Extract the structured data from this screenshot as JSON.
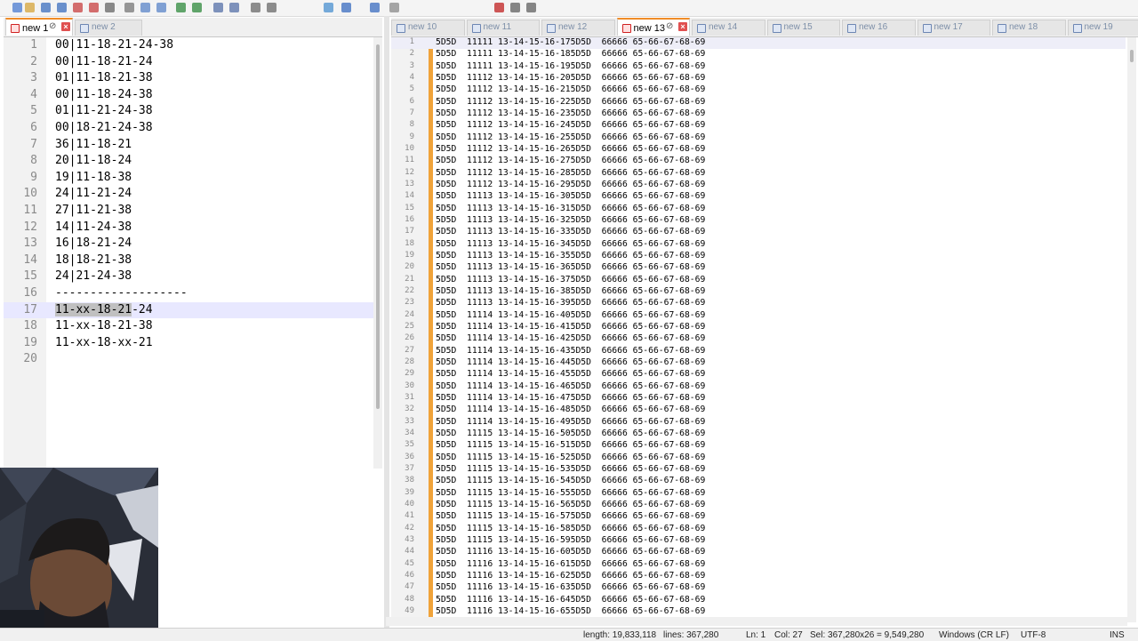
{
  "toolbar": {
    "icons": [
      "new-file-icon",
      "open-file-icon",
      "save-icon",
      "save-all-icon",
      "close-icon",
      "close-all-icon",
      "print-icon",
      "cut-icon",
      "copy-icon",
      "paste-icon",
      "undo-icon",
      "redo-icon",
      "find-icon",
      "replace-icon",
      "zoom-in-icon",
      "zoom-out-icon",
      "sync-scroll-icon",
      "word-wrap-icon",
      "show-all-icon",
      "indent-guide-icon",
      "macro-record-icon",
      "macro-stop-icon",
      "macro-play-icon"
    ]
  },
  "left_tabs": [
    {
      "label": "new 1",
      "active": true
    },
    {
      "label": "new 2",
      "active": false
    }
  ],
  "right_tabs": [
    {
      "label": "new 10",
      "active": false
    },
    {
      "label": "new 11",
      "active": false
    },
    {
      "label": "new 12",
      "active": false
    },
    {
      "label": "new 13",
      "active": true
    },
    {
      "label": "new 14",
      "active": false
    },
    {
      "label": "new 15",
      "active": false
    },
    {
      "label": "new 16",
      "active": false
    },
    {
      "label": "new 17",
      "active": false
    },
    {
      "label": "new 18",
      "active": false
    },
    {
      "label": "new 19",
      "active": false
    }
  ],
  "left_editor": {
    "current_line": 17,
    "highlight": "11-xx-18-21",
    "lines": [
      {
        "n": "1",
        "text": "00|11-18-21-24-38"
      },
      {
        "n": "2",
        "text": "00|11-18-21-24"
      },
      {
        "n": "3",
        "text": "01|11-18-21-38"
      },
      {
        "n": "4",
        "text": "00|11-18-24-38"
      },
      {
        "n": "5",
        "text": "01|11-21-24-38"
      },
      {
        "n": "6",
        "text": "00|18-21-24-38"
      },
      {
        "n": "7",
        "text": "36|11-18-21"
      },
      {
        "n": "8",
        "text": "20|11-18-24"
      },
      {
        "n": "9",
        "text": "19|11-18-38"
      },
      {
        "n": "10",
        "text": "24|11-21-24"
      },
      {
        "n": "11",
        "text": "27|11-21-38"
      },
      {
        "n": "12",
        "text": "14|11-24-38"
      },
      {
        "n": "13",
        "text": "16|18-21-24"
      },
      {
        "n": "14",
        "text": "18|18-21-38"
      },
      {
        "n": "15",
        "text": "24|21-24-38"
      },
      {
        "n": "16",
        "text": "-------------------"
      },
      {
        "n": "17",
        "text": "11-xx-18-21-24"
      },
      {
        "n": "18",
        "text": "11-xx-18-21-38"
      },
      {
        "n": "19",
        "text": "11-xx-18-xx-21"
      },
      {
        "n": "20",
        "text": ""
      }
    ]
  },
  "right_editor": {
    "current_line": 1,
    "lines": [
      {
        "n": "1",
        "text": "5D5D  11111 13-14-15-16-175D5D  66666 65-66-67-68-69"
      },
      {
        "n": "2",
        "text": "5D5D  11111 13-14-15-16-185D5D  66666 65-66-67-68-69"
      },
      {
        "n": "3",
        "text": "5D5D  11111 13-14-15-16-195D5D  66666 65-66-67-68-69"
      },
      {
        "n": "4",
        "text": "5D5D  11112 13-14-15-16-205D5D  66666 65-66-67-68-69"
      },
      {
        "n": "5",
        "text": "5D5D  11112 13-14-15-16-215D5D  66666 65-66-67-68-69"
      },
      {
        "n": "6",
        "text": "5D5D  11112 13-14-15-16-225D5D  66666 65-66-67-68-69"
      },
      {
        "n": "7",
        "text": "5D5D  11112 13-14-15-16-235D5D  66666 65-66-67-68-69"
      },
      {
        "n": "8",
        "text": "5D5D  11112 13-14-15-16-245D5D  66666 65-66-67-68-69"
      },
      {
        "n": "9",
        "text": "5D5D  11112 13-14-15-16-255D5D  66666 65-66-67-68-69"
      },
      {
        "n": "10",
        "text": "5D5D  11112 13-14-15-16-265D5D  66666 65-66-67-68-69"
      },
      {
        "n": "11",
        "text": "5D5D  11112 13-14-15-16-275D5D  66666 65-66-67-68-69"
      },
      {
        "n": "12",
        "text": "5D5D  11112 13-14-15-16-285D5D  66666 65-66-67-68-69"
      },
      {
        "n": "13",
        "text": "5D5D  11112 13-14-15-16-295D5D  66666 65-66-67-68-69"
      },
      {
        "n": "14",
        "text": "5D5D  11113 13-14-15-16-305D5D  66666 65-66-67-68-69"
      },
      {
        "n": "15",
        "text": "5D5D  11113 13-14-15-16-315D5D  66666 65-66-67-68-69"
      },
      {
        "n": "16",
        "text": "5D5D  11113 13-14-15-16-325D5D  66666 65-66-67-68-69"
      },
      {
        "n": "17",
        "text": "5D5D  11113 13-14-15-16-335D5D  66666 65-66-67-68-69"
      },
      {
        "n": "18",
        "text": "5D5D  11113 13-14-15-16-345D5D  66666 65-66-67-68-69"
      },
      {
        "n": "19",
        "text": "5D5D  11113 13-14-15-16-355D5D  66666 65-66-67-68-69"
      },
      {
        "n": "20",
        "text": "5D5D  11113 13-14-15-16-365D5D  66666 65-66-67-68-69"
      },
      {
        "n": "21",
        "text": "5D5D  11113 13-14-15-16-375D5D  66666 65-66-67-68-69"
      },
      {
        "n": "22",
        "text": "5D5D  11113 13-14-15-16-385D5D  66666 65-66-67-68-69"
      },
      {
        "n": "23",
        "text": "5D5D  11113 13-14-15-16-395D5D  66666 65-66-67-68-69"
      },
      {
        "n": "24",
        "text": "5D5D  11114 13-14-15-16-405D5D  66666 65-66-67-68-69"
      },
      {
        "n": "25",
        "text": "5D5D  11114 13-14-15-16-415D5D  66666 65-66-67-68-69"
      },
      {
        "n": "26",
        "text": "5D5D  11114 13-14-15-16-425D5D  66666 65-66-67-68-69"
      },
      {
        "n": "27",
        "text": "5D5D  11114 13-14-15-16-435D5D  66666 65-66-67-68-69"
      },
      {
        "n": "28",
        "text": "5D5D  11114 13-14-15-16-445D5D  66666 65-66-67-68-69"
      },
      {
        "n": "29",
        "text": "5D5D  11114 13-14-15-16-455D5D  66666 65-66-67-68-69"
      },
      {
        "n": "30",
        "text": "5D5D  11114 13-14-15-16-465D5D  66666 65-66-67-68-69"
      },
      {
        "n": "31",
        "text": "5D5D  11114 13-14-15-16-475D5D  66666 65-66-67-68-69"
      },
      {
        "n": "32",
        "text": "5D5D  11114 13-14-15-16-485D5D  66666 65-66-67-68-69"
      },
      {
        "n": "33",
        "text": "5D5D  11114 13-14-15-16-495D5D  66666 65-66-67-68-69"
      },
      {
        "n": "34",
        "text": "5D5D  11115 13-14-15-16-505D5D  66666 65-66-67-68-69"
      },
      {
        "n": "35",
        "text": "5D5D  11115 13-14-15-16-515D5D  66666 65-66-67-68-69"
      },
      {
        "n": "36",
        "text": "5D5D  11115 13-14-15-16-525D5D  66666 65-66-67-68-69"
      },
      {
        "n": "37",
        "text": "5D5D  11115 13-14-15-16-535D5D  66666 65-66-67-68-69"
      },
      {
        "n": "38",
        "text": "5D5D  11115 13-14-15-16-545D5D  66666 65-66-67-68-69"
      },
      {
        "n": "39",
        "text": "5D5D  11115 13-14-15-16-555D5D  66666 65-66-67-68-69"
      },
      {
        "n": "40",
        "text": "5D5D  11115 13-14-15-16-565D5D  66666 65-66-67-68-69"
      },
      {
        "n": "41",
        "text": "5D5D  11115 13-14-15-16-575D5D  66666 65-66-67-68-69"
      },
      {
        "n": "42",
        "text": "5D5D  11115 13-14-15-16-585D5D  66666 65-66-67-68-69"
      },
      {
        "n": "43",
        "text": "5D5D  11115 13-14-15-16-595D5D  66666 65-66-67-68-69"
      },
      {
        "n": "44",
        "text": "5D5D  11116 13-14-15-16-605D5D  66666 65-66-67-68-69"
      },
      {
        "n": "45",
        "text": "5D5D  11116 13-14-15-16-615D5D  66666 65-66-67-68-69"
      },
      {
        "n": "46",
        "text": "5D5D  11116 13-14-15-16-625D5D  66666 65-66-67-68-69"
      },
      {
        "n": "47",
        "text": "5D5D  11116 13-14-15-16-635D5D  66666 65-66-67-68-69"
      },
      {
        "n": "48",
        "text": "5D5D  11116 13-14-15-16-645D5D  66666 65-66-67-68-69"
      },
      {
        "n": "49",
        "text": "5D5D  11116 13-14-15-16-655D5D  66666 65-66-67-68-69"
      }
    ]
  },
  "statusbar": {
    "length": "length: 19,833,118",
    "lines": "lines: 367,280",
    "ln": "Ln: 1",
    "col": "Col: 27",
    "sel": "Sel: 367,280x26 = 9,549,280",
    "eol": "Windows (CR LF)",
    "encoding": "UTF-8",
    "mode": "INS"
  },
  "colors": {
    "active_tab_accent": "#f08c28",
    "change_history_edge": "#f0a33a",
    "current_line_bg": "#e8e8ff"
  }
}
